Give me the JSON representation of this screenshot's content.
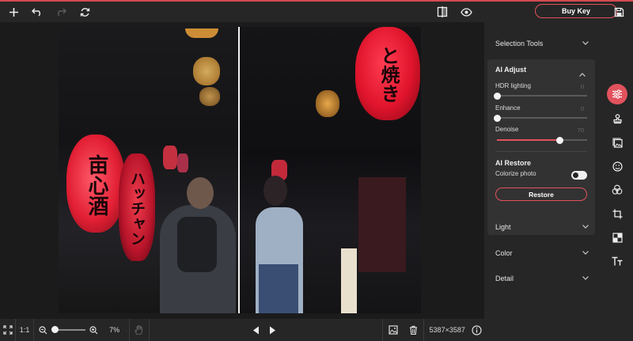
{
  "colors": {
    "accent": "#e2525d",
    "panel_bg": "#262626",
    "card_bg": "#323232",
    "app_bg": "#1b1b1b"
  },
  "toolbar": {
    "icons": [
      "plus-icon",
      "undo-icon",
      "redo-icon",
      "sync-icon",
      "compare-icon",
      "eye-icon"
    ],
    "buy_key_label": "Buy Key",
    "save_icon": "save-icon"
  },
  "photo": {
    "lantern_left_text": "亩心酒",
    "lantern_mid_text": "ハッチャン",
    "lantern_right_text": "と焼き"
  },
  "bottombar": {
    "fit_icon": "fit-screen-icon",
    "one_to_one_label": "1:1",
    "zoom_percent_label": "7%",
    "zoom_level": 0.07,
    "hand_icon": "hand-icon",
    "prev_icon": "prev-icon",
    "next_icon": "next-icon",
    "image_icon": "image-icon",
    "trash_icon": "trash-icon",
    "dimensions_label": "5387×3587",
    "info_icon": "info-icon"
  },
  "panel": {
    "selection_tools_label": "Selection Tools",
    "ai_adjust": {
      "title": "AI Adjust",
      "hdr_label": "HDR lighting",
      "hdr_value": "0",
      "enhance_label": "Enhance",
      "enhance_value": "0",
      "denoise_label": "Denoise",
      "denoise_value": "70"
    },
    "ai_restore": {
      "title": "AI Restore",
      "colorize_label": "Colorize photo",
      "colorize_on": false,
      "restore_button": "Restore"
    },
    "light_label": "Light",
    "color_label": "Color",
    "detail_label": "Detail"
  },
  "rail": {
    "icons": [
      "sliders-icon",
      "stamp-icon",
      "image-adjust-icon",
      "smiley-icon",
      "color-circles-icon",
      "crop-icon",
      "aspect-icon",
      "text-icon"
    ],
    "active": "sliders-icon"
  }
}
